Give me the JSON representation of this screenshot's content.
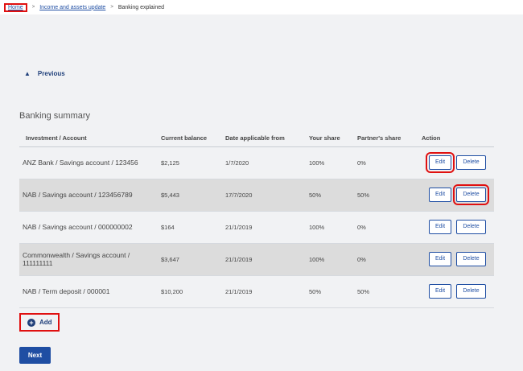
{
  "breadcrumb": {
    "home": "Home",
    "parent": "Income and assets update",
    "current": "Banking explained",
    "separator": ">"
  },
  "nav": {
    "previous_label": "Previous"
  },
  "summary": {
    "title": "Banking summary",
    "headers": {
      "account": "Investment / Account",
      "balance": "Current balance",
      "date": "Date applicable from",
      "share": "Your share",
      "partner": "Partner's share",
      "action": "Action"
    },
    "rows": [
      {
        "account": "ANZ Bank / Savings account / 123456",
        "balance": "$2,125",
        "date": "1/7/2020",
        "share": "100%",
        "partner": "0%",
        "edit": "Edit",
        "delete": "Delete"
      },
      {
        "account": "NAB / Savings account / 123456789",
        "balance": "$5,443",
        "date": "17/7/2020",
        "share": "50%",
        "partner": "50%",
        "edit": "Edit",
        "delete": "Delete"
      },
      {
        "account": "NAB / Savings account / 000000002",
        "balance": "$164",
        "date": "21/1/2019",
        "share": "100%",
        "partner": "0%",
        "edit": "Edit",
        "delete": "Delete"
      },
      {
        "account": "Commonwealth / Savings account / 111111111",
        "balance": "$3,647",
        "date": "21/1/2019",
        "share": "100%",
        "partner": "0%",
        "edit": "Edit",
        "delete": "Delete"
      },
      {
        "account": "NAB / Term deposit / 000001",
        "balance": "$10,200",
        "date": "21/1/2019",
        "share": "50%",
        "partner": "50%",
        "edit": "Edit",
        "delete": "Delete"
      }
    ]
  },
  "actions": {
    "add_label": "Add",
    "next_label": "Next"
  },
  "icons": {
    "previous": "chevron-up-icon",
    "add": "plus-circle-icon"
  },
  "colors": {
    "accent": "#1f4ea3",
    "highlight": "#e01010",
    "background": "#f1f2f4",
    "row_alt": "#dcdcdc"
  }
}
